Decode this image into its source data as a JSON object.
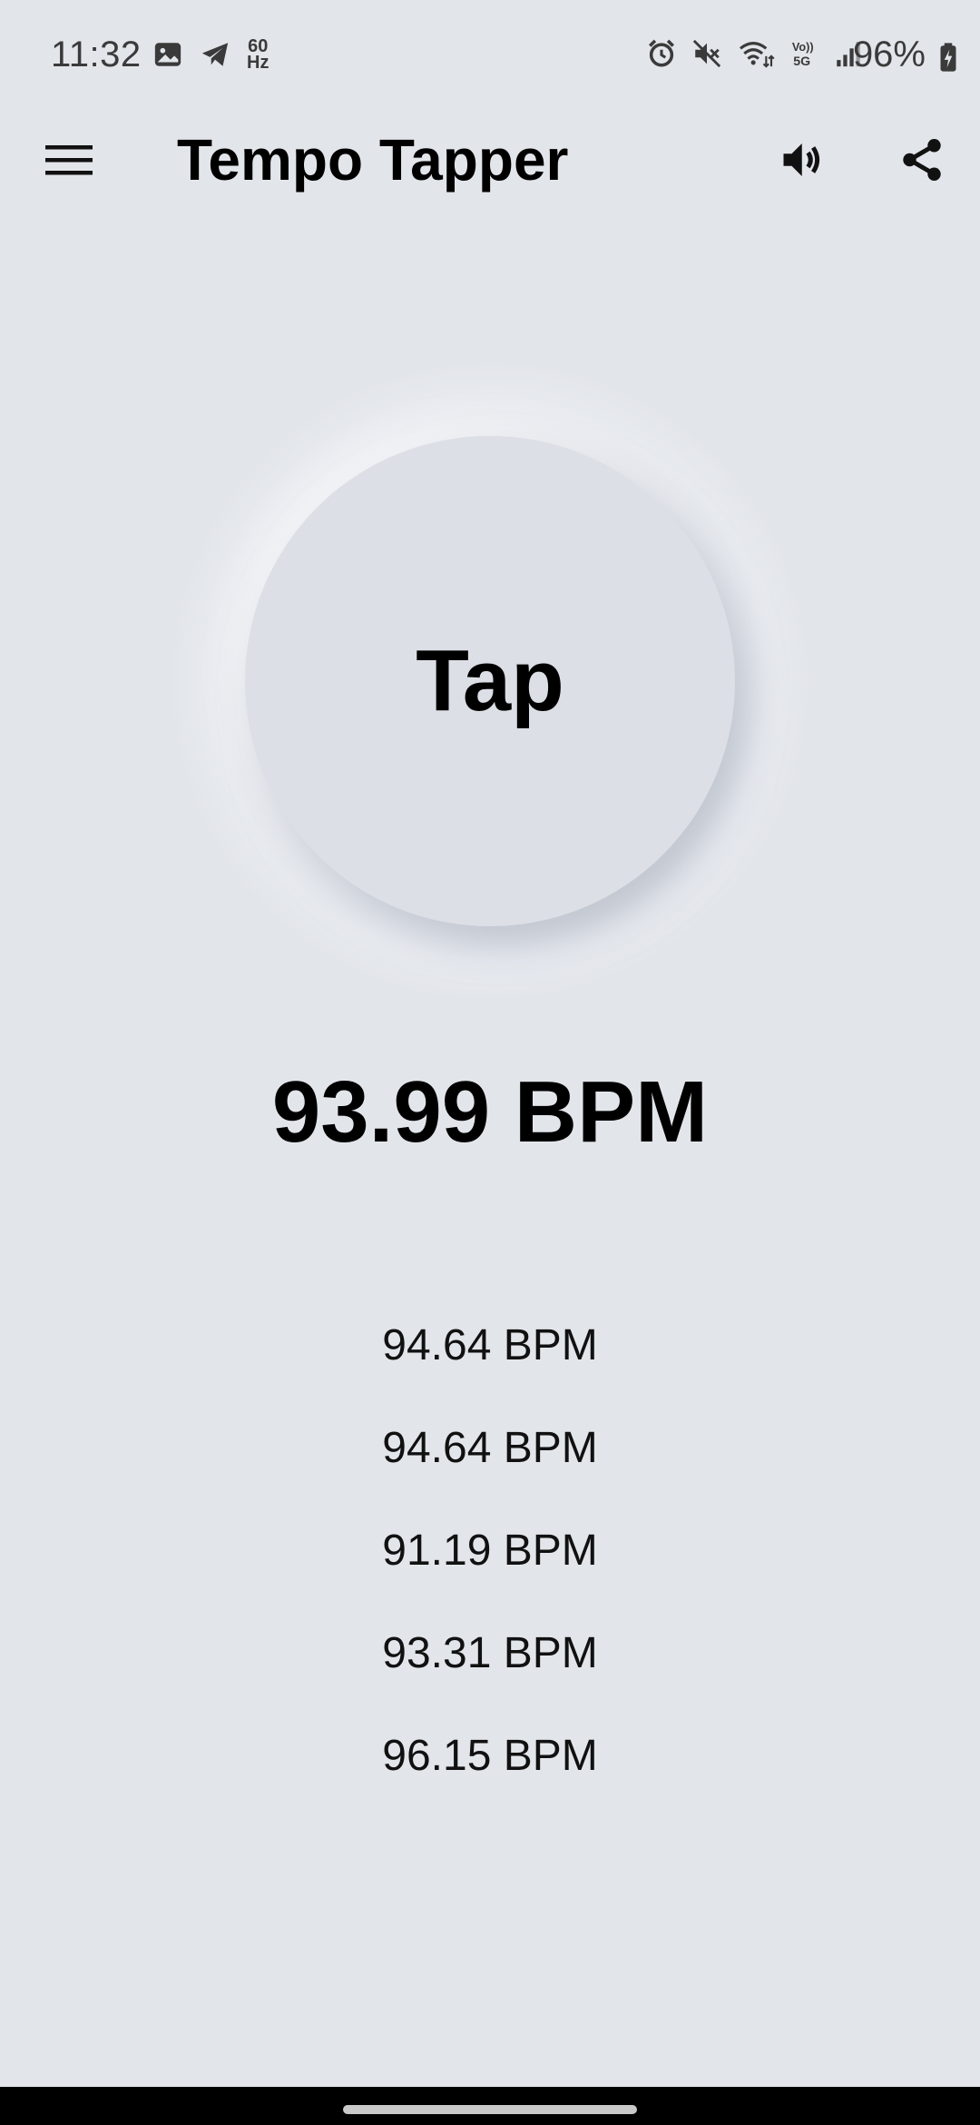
{
  "status_bar": {
    "time": "11:32",
    "refresh_rate_top": "60",
    "refresh_rate_bottom": "Hz",
    "battery_percent": "96%",
    "left_icons": [
      "gallery-icon",
      "telegram-icon"
    ],
    "right_icons": [
      "alarm-icon",
      "mute-icon",
      "wifi-icon",
      "volte-5g-icon",
      "signal-icon"
    ]
  },
  "app_bar": {
    "title": "Tempo Tapper",
    "menu_icon": "hamburger-menu-icon",
    "sound_icon": "speaker-icon",
    "share_icon": "share-icon"
  },
  "tap_button": {
    "label": "Tap"
  },
  "current_bpm": "93.99 BPM",
  "history": [
    "94.64 BPM",
    "94.64 BPM",
    "91.19 BPM",
    "93.31 BPM",
    "96.15 BPM"
  ],
  "colors": {
    "background": "#e2e5ea",
    "button": "#dcdfe5",
    "text": "#000000",
    "nav_bar": "#000000"
  }
}
